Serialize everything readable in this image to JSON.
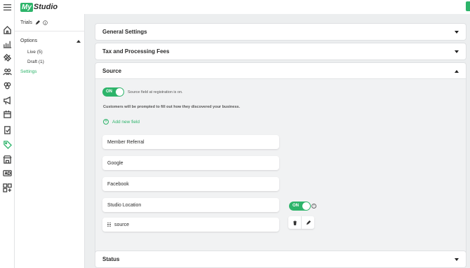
{
  "brand": {
    "logo_my": "My",
    "logo_studio": "Studio",
    "accent": "#2db46a"
  },
  "rail_icons": [
    "menu-icon",
    "home-icon",
    "chart-icon",
    "ticket-icon",
    "users-icon",
    "group-icon",
    "megaphone-icon",
    "calendar-icon",
    "clipboard-icon",
    "tag-icon",
    "store-icon",
    "ad-icon",
    "apps-icon"
  ],
  "sidebar": {
    "title": "Trials",
    "options_label": "Options",
    "items": [
      {
        "label": "Live (5)"
      },
      {
        "label": "Draft (1)"
      }
    ],
    "settings_label": "Settings"
  },
  "panels": {
    "general": "General Settings",
    "fees": "Tax and Processing Fees",
    "source": "Source",
    "status": "Status"
  },
  "source": {
    "toggle_label": "ON",
    "toggle_note": "Source field at registration is on.",
    "prompt_note": "Customers will be prompted to fill out how they discovered your business.",
    "add_field": "Add new field",
    "fields": [
      "Member Referral",
      "Google",
      "Facebook",
      "Studio Location",
      "source"
    ],
    "location_toggle_label": "ON",
    "info_glyph": "i"
  }
}
